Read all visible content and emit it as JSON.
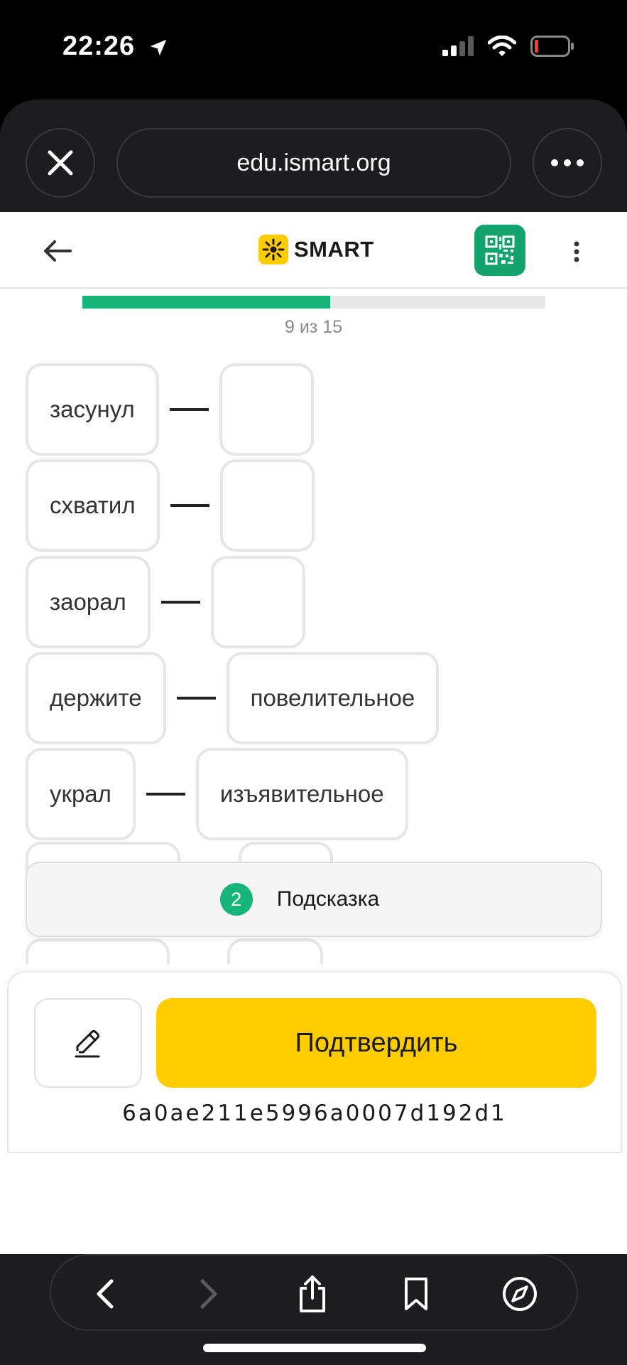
{
  "status_bar": {
    "time": "22:26"
  },
  "browser": {
    "url": "edu.ismart.org"
  },
  "header": {
    "logo_text": "SMART"
  },
  "progress": {
    "current": 9,
    "total": 15,
    "label": "9 из 15",
    "fraction": 0.536
  },
  "rows": [
    {
      "word": "засунул",
      "answer": ""
    },
    {
      "word": "схватил",
      "answer": ""
    },
    {
      "word": "заорал",
      "answer": ""
    },
    {
      "word": "держите",
      "answer": "повелительное"
    },
    {
      "word": "украл",
      "answer": "изъявительное"
    }
  ],
  "hint": {
    "count": "2",
    "label": "Подсказка"
  },
  "actions": {
    "confirm_label": "Подтвердить"
  },
  "task_id": "6a0ae211e5996a0007d192d1",
  "colors": {
    "accent_green": "#17b57a",
    "accent_yellow": "#ffcc00"
  }
}
